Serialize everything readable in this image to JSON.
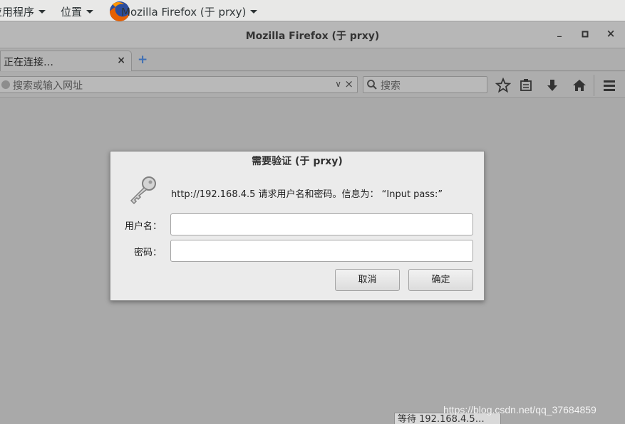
{
  "topbar": {
    "applications_label": "应用程序",
    "places_label": "位置",
    "active_app_label": "Mozilla Firefox (于  prxy)"
  },
  "window": {
    "title": "Mozilla Firefox (于  prxy)",
    "minimize_glyph": "_",
    "maximize_glyph": "□",
    "close_glyph": "×"
  },
  "tabs": [
    {
      "label": "正在连接…",
      "close_glyph": "×"
    }
  ],
  "new_tab_glyph": "+",
  "navbar": {
    "url_placeholder": "搜索或输入网址",
    "url_dropdown_glyph": "∨",
    "url_clear_glyph": "×",
    "search_placeholder": "搜索",
    "icons": [
      "bookmark-star-icon",
      "reading-list-icon",
      "download-icon",
      "home-icon",
      "hamburger-menu-icon"
    ]
  },
  "dialog": {
    "title": "需要验证 (于  prxy)",
    "message": "http://192.168.4.5 请求用户名和密码。信息为：  “Input pass:”",
    "username_label": "用户名：",
    "password_label": "密码：",
    "username_value": "",
    "password_value": "",
    "cancel_label": "取消",
    "ok_label": "确定"
  },
  "status": {
    "text": "等待 192.168.4.5…"
  },
  "watermark": "https://blog.csdn.net/qq_37684859",
  "colors": {
    "desktop_bg": "#a9a9a9",
    "topbar_bg": "#e8e8e7",
    "dialog_bg": "#ebebeb",
    "newtab_accent": "#3d6fb5"
  }
}
